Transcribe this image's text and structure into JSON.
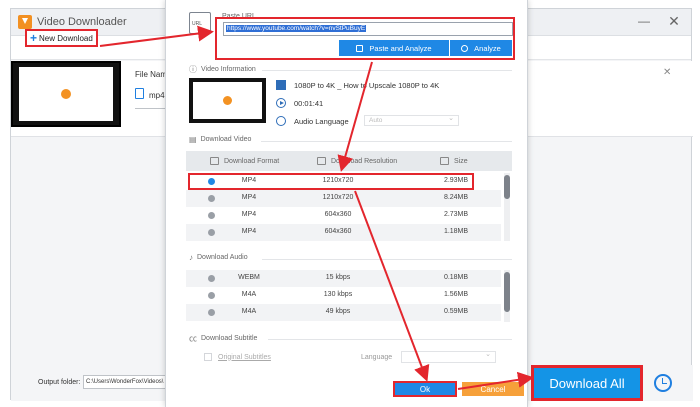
{
  "app": {
    "title": "Video Downloader",
    "minimize": "—",
    "close": "✕"
  },
  "toolbar": {
    "new_download_label": "New Download",
    "plus": "+"
  },
  "task": {
    "file_name_label": "File Name:",
    "format": "mp4",
    "close": "✕"
  },
  "bottom": {
    "output_folder_label": "Output folder:",
    "output_folder_value": "C:\\Users\\WonderFox\\Videos\\",
    "download_all_label": "Download All"
  },
  "dialog": {
    "paste_url_label": "Paste URL",
    "url_value": "https://www.youtube.com/watch?v=nvStPuBuyE",
    "paste_and_analyze_label": "Paste and Analyze",
    "analyze_label": "Analyze",
    "video_info_label": "Video Information",
    "video_title": "1080P to 4K _ How to Upscale 1080P to 4K",
    "duration": "00:01:41",
    "audio_language_label": "Audio Language",
    "audio_language_value": "Auto",
    "download_video_label": "Download Video",
    "video_columns": {
      "format": "Download Format",
      "resolution": "Download Resolution",
      "size": "Size"
    },
    "video_rows": [
      {
        "format": "MP4",
        "resolution": "1210x720",
        "size": "2.93MB",
        "selected": true
      },
      {
        "format": "MP4",
        "resolution": "1210x720",
        "size": "8.24MB",
        "selected": false
      },
      {
        "format": "MP4",
        "resolution": "604x360",
        "size": "2.73MB",
        "selected": false
      },
      {
        "format": "MP4",
        "resolution": "604x360",
        "size": "1.18MB",
        "selected": false
      }
    ],
    "download_audio_label": "Download Audio",
    "audio_rows": [
      {
        "format": "WEBM",
        "bitrate": "15 kbps",
        "size": "0.18MB"
      },
      {
        "format": "M4A",
        "bitrate": "130 kbps",
        "size": "1.56MB"
      },
      {
        "format": "M4A",
        "bitrate": "49 kbps",
        "size": "0.59MB"
      }
    ],
    "download_subtitle_label": "Download Subtitle",
    "original_subtitles_label": "Original Subtitles",
    "subtitle_language_label": "Language",
    "ok_label": "Ok",
    "cancel_label": "Cancel"
  },
  "colors": {
    "accent": "#1f88e5",
    "highlight": "#e3262d",
    "cancel": "#f6a03a",
    "brand": "#f29022"
  }
}
